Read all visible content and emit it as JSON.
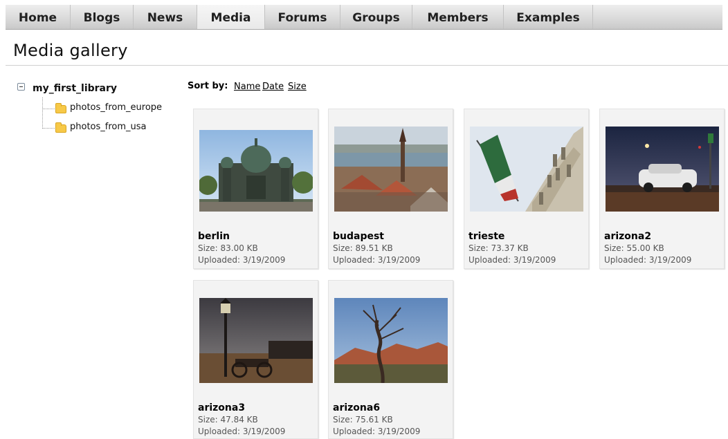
{
  "nav": {
    "items": [
      {
        "label": "Home"
      },
      {
        "label": "Blogs"
      },
      {
        "label": "News"
      },
      {
        "label": "Media"
      },
      {
        "label": "Forums"
      },
      {
        "label": "Groups"
      },
      {
        "label": "Members"
      },
      {
        "label": "Examples"
      }
    ],
    "active": "Media"
  },
  "page": {
    "title": "Media gallery"
  },
  "tree": {
    "root": "my_first_library",
    "children": [
      {
        "label": "photos_from_europe",
        "icon": "folder-icon"
      },
      {
        "label": "photos_from_usa",
        "icon": "folder-icon"
      }
    ],
    "toggle_icon": "collapse-icon"
  },
  "sort": {
    "label": "Sort by:",
    "options": [
      "Name",
      "Date",
      "Size"
    ]
  },
  "gallery": {
    "items": [
      {
        "name": "berlin",
        "size": "Size:  83.00 KB",
        "uploaded": "Uploaded: 3/19/2009"
      },
      {
        "name": "budapest",
        "size": "Size:  89.51 KB",
        "uploaded": "Uploaded: 3/19/2009"
      },
      {
        "name": "trieste",
        "size": "Size:  73.37 KB",
        "uploaded": "Uploaded: 3/19/2009"
      },
      {
        "name": "arizona2",
        "size": "Size:  55.00 KB",
        "uploaded": "Uploaded: 3/19/2009"
      },
      {
        "name": "arizona3",
        "size": "Size:  47.84 KB",
        "uploaded": "Uploaded: 3/19/2009"
      },
      {
        "name": "arizona6",
        "size": "Size:  75.61 KB",
        "uploaded": "Uploaded: 3/19/2009"
      }
    ]
  }
}
